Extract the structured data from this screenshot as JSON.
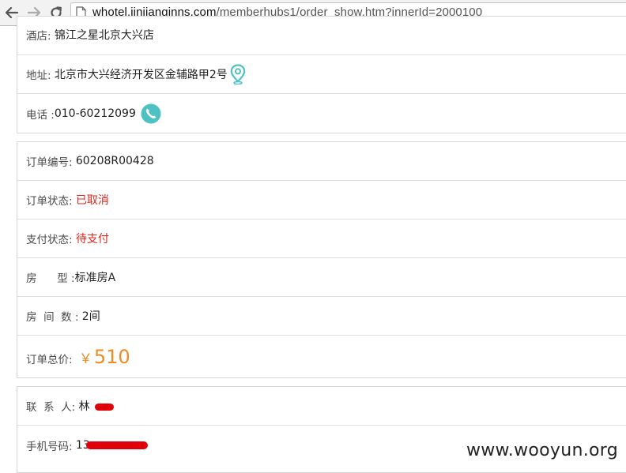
{
  "browser": {
    "url_host": "whotel.jinjianginns.com",
    "url_path": "/memberhubs1/order_show.htm?innerId=2000100"
  },
  "hotel_section": {
    "hotel_label": "酒店: ",
    "hotel_value": "锦江之星北京大兴店",
    "address_label": "地址: ",
    "address_value": "北京市大兴经济开发区金辅路甲2号",
    "phone_label": "电话 :",
    "phone_value": "010-60212099"
  },
  "order_section": {
    "order_no_label": "订单编号: ",
    "order_no_value": "60208R00428",
    "order_status_label": "订单状态: ",
    "order_status_value": "已取消",
    "pay_status_label": "支付状态: ",
    "pay_status_value": "待支付",
    "room_type_label": "房      型 :",
    "room_type_value": "标准房A",
    "room_count_label": "房  间  数 : ",
    "room_count_value": "2间",
    "total_label": "订单总价: ",
    "total_currency": "￥",
    "total_value": "510"
  },
  "contact_section": {
    "contact_label": "联  系  人: ",
    "contact_value": "林",
    "mobile_label": "手机号码: ",
    "mobile_value": "13"
  },
  "watermark": "www.wooyun.org",
  "colors": {
    "status_red": "#e0251b",
    "price_orange": "#f08a24",
    "icon_teal": "#4fc1c3",
    "redaction_red": "#e0000a"
  }
}
